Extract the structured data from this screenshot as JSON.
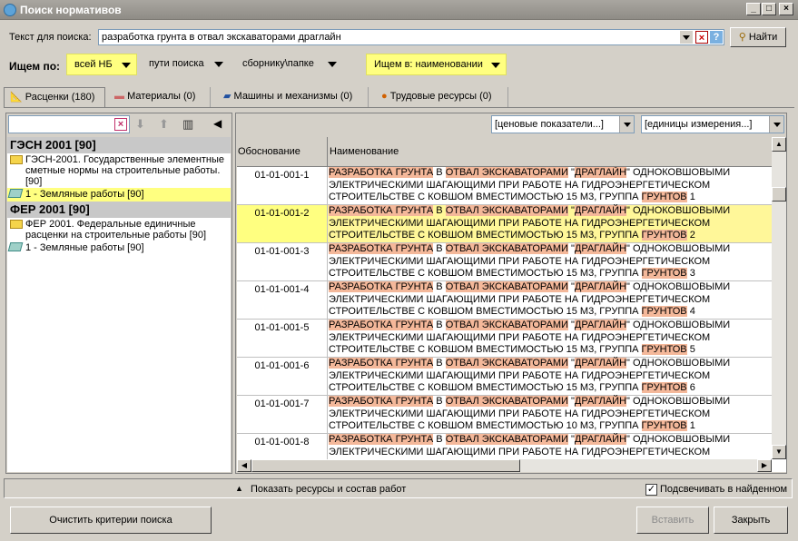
{
  "window": {
    "title": "Поиск нормативов"
  },
  "search": {
    "label": "Текст для поиска:",
    "value": "разработка грунта в отвал экскаваторами драглайн",
    "find_label": "Найти"
  },
  "filters": {
    "label": "Ищем по:",
    "nb": "всей НБ",
    "paths": "пути поиска",
    "collection": "сборнику\\папке",
    "search_in": "Ищем в: наименовании"
  },
  "tabs": [
    {
      "label": "Расценки (180)",
      "icon": "ruler-icon"
    },
    {
      "label": "Материалы (0)",
      "icon": "bricks-icon"
    },
    {
      "label": "Машины и механизмы (0)",
      "icon": "truck-icon"
    },
    {
      "label": "Трудовые ресурсы (0)",
      "icon": "worker-icon"
    }
  ],
  "tree": {
    "groups": [
      {
        "title": "ГЭСН 2001 [90]",
        "folder": "ГЭСН-2001. Государственные элементные сметные нормы на строительные работы. [90]",
        "item": "1 - Земляные работы [90]"
      },
      {
        "title": "ФЕР 2001 [90]",
        "folder": "ФЕР 2001. Федеральные единичные расценки на строительные работы [90]",
        "item": "1 - Земляные работы [90]"
      }
    ]
  },
  "grid": {
    "price_indicators": "[ценовые показатели...]",
    "units": "[единицы измерения...]",
    "col_code": "Обоснование",
    "col_name": "Наименование",
    "rows": [
      {
        "code": "01-01-001-1",
        "l1": [
          "РАЗРАБОТКА ГРУНТА",
          " В ",
          "ОТВАЛ ЭКСКАВАТОРАМИ",
          " \"",
          "ДРАГЛАЙН",
          "\" ОДНОКОВШОВЫМИ"
        ],
        "l2": "ЭЛЕКТРИЧЕСКИМИ ШАГАЮЩИМИ ПРИ РАБОТЕ НА ГИДРОЭНЕРГЕТИЧЕСКОМ",
        "l3a": "СТРОИТЕЛЬСТВЕ С КОВШОМ ВМЕСТИМОСТЬЮ 15 М3, ГРУППА ",
        "l3b": "ГРУНТОВ",
        "l3c": " 1"
      },
      {
        "code": "01-01-001-2",
        "l1": [
          "РАЗРАБОТКА ГРУНТА",
          " В ",
          "ОТВАЛ ЭКСКАВАТОРАМИ",
          " \"",
          "ДРАГЛАЙН",
          "\" ОДНОКОВШОВЫМИ"
        ],
        "l2": "ЭЛЕКТРИЧЕСКИМИ ШАГАЮЩИМИ ПРИ РАБОТЕ НА ГИДРОЭНЕРГЕТИЧЕСКОМ",
        "l3a": "СТРОИТЕЛЬСТВЕ С КОВШОМ ВМЕСТИМОСТЬЮ 15 М3, ГРУППА ",
        "l3b": "ГРУНТОВ",
        "l3c": " 2"
      },
      {
        "code": "01-01-001-3",
        "l1": [
          "РАЗРАБОТКА ГРУНТА",
          " В ",
          "ОТВАЛ ЭКСКАВАТОРАМИ",
          " \"",
          "ДРАГЛАЙН",
          "\" ОДНОКОВШОВЫМИ"
        ],
        "l2": "ЭЛЕКТРИЧЕСКИМИ ШАГАЮЩИМИ ПРИ РАБОТЕ НА ГИДРОЭНЕРГЕТИЧЕСКОМ",
        "l3a": "СТРОИТЕЛЬСТВЕ С КОВШОМ ВМЕСТИМОСТЬЮ 15 М3, ГРУППА ",
        "l3b": "ГРУНТОВ",
        "l3c": " 3"
      },
      {
        "code": "01-01-001-4",
        "l1": [
          "РАЗРАБОТКА ГРУНТА",
          " В ",
          "ОТВАЛ ЭКСКАВАТОРАМИ",
          " \"",
          "ДРАГЛАЙН",
          "\" ОДНОКОВШОВЫМИ"
        ],
        "l2": "ЭЛЕКТРИЧЕСКИМИ ШАГАЮЩИМИ ПРИ РАБОТЕ НА ГИДРОЭНЕРГЕТИЧЕСКОМ",
        "l3a": "СТРОИТЕЛЬСТВЕ С КОВШОМ ВМЕСТИМОСТЬЮ 15 М3, ГРУППА ",
        "l3b": "ГРУНТОВ",
        "l3c": " 4"
      },
      {
        "code": "01-01-001-5",
        "l1": [
          "РАЗРАБОТКА ГРУНТА",
          " В ",
          "ОТВАЛ ЭКСКАВАТОРАМИ",
          " \"",
          "ДРАГЛАЙН",
          "\" ОДНОКОВШОВЫМИ"
        ],
        "l2": "ЭЛЕКТРИЧЕСКИМИ ШАГАЮЩИМИ ПРИ РАБОТЕ НА ГИДРОЭНЕРГЕТИЧЕСКОМ",
        "l3a": "СТРОИТЕЛЬСТВЕ С КОВШОМ ВМЕСТИМОСТЬЮ 15 М3, ГРУППА ",
        "l3b": "ГРУНТОВ",
        "l3c": " 5"
      },
      {
        "code": "01-01-001-6",
        "l1": [
          "РАЗРАБОТКА ГРУНТА",
          " В ",
          "ОТВАЛ ЭКСКАВАТОРАМИ",
          " \"",
          "ДРАГЛАЙН",
          "\" ОДНОКОВШОВЫМИ"
        ],
        "l2": "ЭЛЕКТРИЧЕСКИМИ ШАГАЮЩИМИ ПРИ РАБОТЕ НА ГИДРОЭНЕРГЕТИЧЕСКОМ",
        "l3a": "СТРОИТЕЛЬСТВЕ С КОВШОМ ВМЕСТИМОСТЬЮ 15 М3, ГРУППА ",
        "l3b": "ГРУНТОВ",
        "l3c": " 6"
      },
      {
        "code": "01-01-001-7",
        "l1": [
          "РАЗРАБОТКА ГРУНТА",
          " В ",
          "ОТВАЛ ЭКСКАВАТОРАМИ",
          " \"",
          "ДРАГЛАЙН",
          "\" ОДНОКОВШОВЫМИ"
        ],
        "l2": "ЭЛЕКТРИЧЕСКИМИ ШАГАЮЩИМИ ПРИ РАБОТЕ НА ГИДРОЭНЕРГЕТИЧЕСКОМ",
        "l3a": "СТРОИТЕЛЬСТВЕ С КОВШОМ ВМЕСТИМОСТЬЮ 10 М3, ГРУППА ",
        "l3b": "ГРУНТОВ",
        "l3c": " 1"
      },
      {
        "code": "01-01-001-8",
        "l1": [
          "РАЗРАБОТКА ГРУНТА",
          " В ",
          "ОТВАЛ ЭКСКАВАТОРАМИ",
          " \"",
          "ДРАГЛАЙН",
          "\" ОДНОКОВШОВЫМИ"
        ],
        "l2": "ЭЛЕКТРИЧЕСКИМИ ШАГАЮЩИМИ ПРИ РАБОТЕ НА ГИДРОЭНЕРГЕТИЧЕСКОМ",
        "l3a": "",
        "l3b": "",
        "l3c": ""
      }
    ]
  },
  "bottom": {
    "show_resources": "Показать ресурсы и состав работ",
    "highlight": "Подсвечивать в найденном",
    "clear": "Очистить критерии поиска",
    "insert": "Вставить",
    "close": "Закрыть"
  },
  "colors": {
    "highlight": "#f4b89a",
    "selected_row": "#fff799",
    "yellow_button": "#ffff80"
  }
}
